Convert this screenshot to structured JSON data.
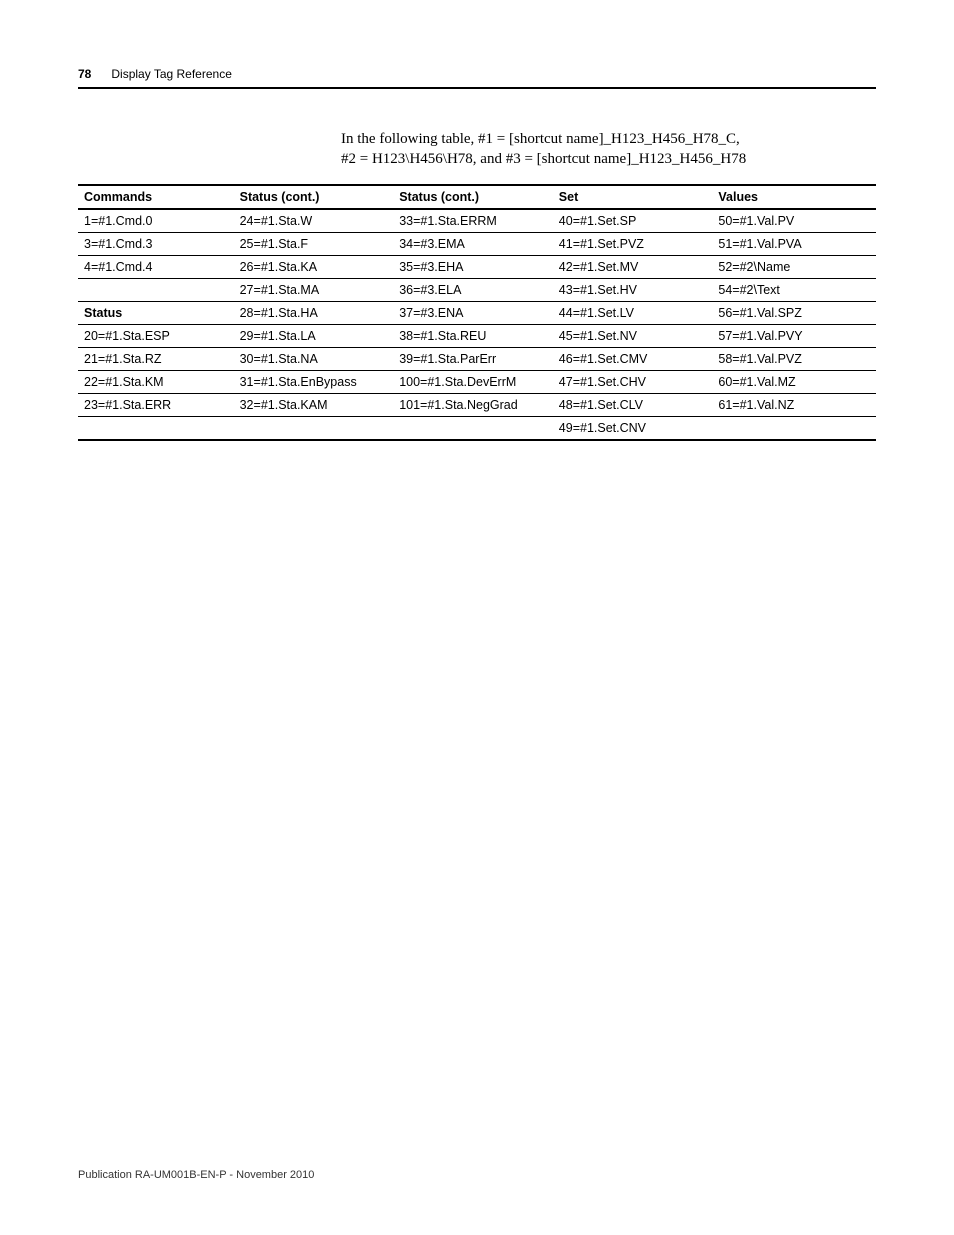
{
  "header": {
    "page_number": "78",
    "section": "Display Tag Reference"
  },
  "intro": {
    "line1": "In the following table, #1 = [shortcut name]_H123_H456_H78_C,",
    "line2": "#2 = H123\\H456\\H78, and #3 = [shortcut name]_H123_H456_H78"
  },
  "table": {
    "headers": [
      "Commands",
      "Status (cont.)",
      "Status (cont.)",
      "Set",
      "Values"
    ],
    "rows": [
      {
        "c0": "1=#1.Cmd.0",
        "c1": "24=#1.Sta.W",
        "c2": "33=#1.Sta.ERRM",
        "c3": "40=#1.Set.SP",
        "c4": "50=#1.Val.PV"
      },
      {
        "c0": "3=#1.Cmd.3",
        "c1": "25=#1.Sta.F",
        "c2": "34=#3.EMA",
        "c3": "41=#1.Set.PVZ",
        "c4": "51=#1.Val.PVA"
      },
      {
        "c0": "4=#1.Cmd.4",
        "c1": "26=#1.Sta.KA",
        "c2": "35=#3.EHA",
        "c3": "42=#1.Set.MV",
        "c4": "52=#2\\Name"
      },
      {
        "c0": "",
        "c1": "27=#1.Sta.MA",
        "c2": "36=#3.ELA",
        "c3": "43=#1.Set.HV",
        "c4": "54=#2\\Text"
      },
      {
        "c0": "Status",
        "c0_head": true,
        "c1": "28=#1.Sta.HA",
        "c2": "37=#3.ENA",
        "c3": "44=#1.Set.LV",
        "c4": "56=#1.Val.SPZ"
      },
      {
        "c0": "20=#1.Sta.ESP",
        "c1": "29=#1.Sta.LA",
        "c2": "38=#1.Sta.REU",
        "c3": "45=#1.Set.NV",
        "c4": "57=#1.Val.PVY"
      },
      {
        "c0": "21=#1.Sta.RZ",
        "c1": "30=#1.Sta.NA",
        "c2": "39=#1.Sta.ParErr",
        "c3": "46=#1.Set.CMV",
        "c4": "58=#1.Val.PVZ"
      },
      {
        "c0": "22=#1.Sta.KM",
        "c1": "31=#1.Sta.EnBypass",
        "c2": "100=#1.Sta.DevErrM",
        "c3": "47=#1.Set.CHV",
        "c4": "60=#1.Val.MZ"
      },
      {
        "c0": "23=#1.Sta.ERR",
        "c1": "32=#1.Sta.KAM",
        "c2": "101=#1.Sta.NegGrad",
        "c3": "48=#1.Set.CLV",
        "c4": "61=#1.Val.NZ"
      },
      {
        "c0": "",
        "c1": "",
        "c2": "",
        "c3": "49=#1.Set.CNV",
        "c4": ""
      }
    ]
  },
  "footer": "Publication RA-UM001B-EN-P - November 2010"
}
